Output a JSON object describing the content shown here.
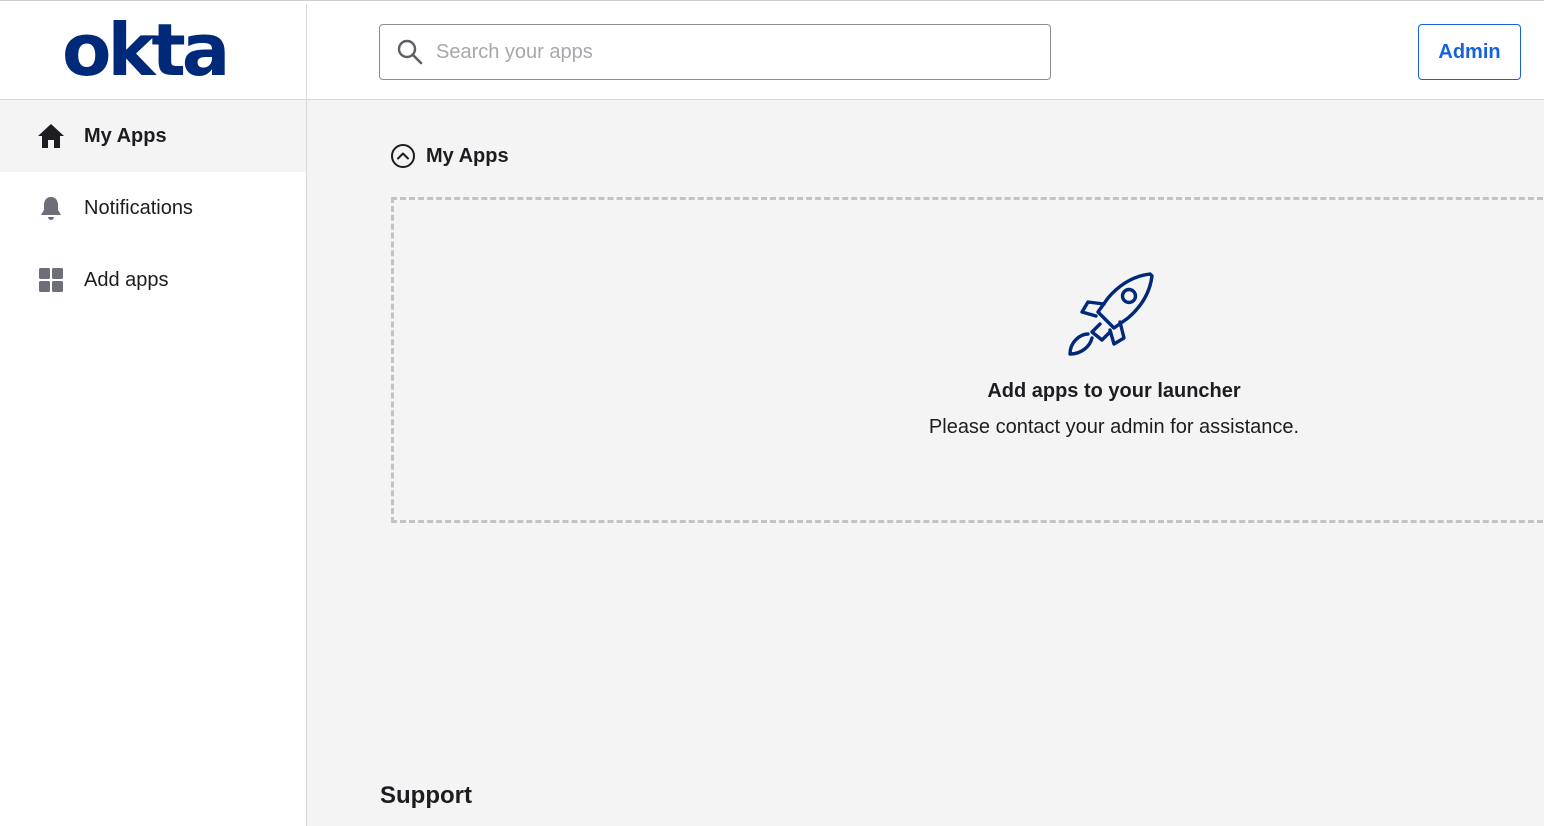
{
  "brand": {
    "logo_text": "okta",
    "color": "#00297a"
  },
  "header": {
    "search_placeholder": "Search your apps",
    "search_value": "",
    "admin_label": "Admin",
    "accent": "#1662dd"
  },
  "sidebar": {
    "items": [
      {
        "label": "My Apps",
        "icon": "home-icon",
        "active": true
      },
      {
        "label": "Notifications",
        "icon": "bell-icon",
        "active": false
      },
      {
        "label": "Add apps",
        "icon": "grid-icon",
        "active": false
      }
    ]
  },
  "main": {
    "section_title": "My Apps",
    "empty_state": {
      "icon": "rocket-icon",
      "title": "Add apps to your launcher",
      "subtitle": "Please contact your admin for assistance."
    },
    "support_heading": "Support"
  }
}
